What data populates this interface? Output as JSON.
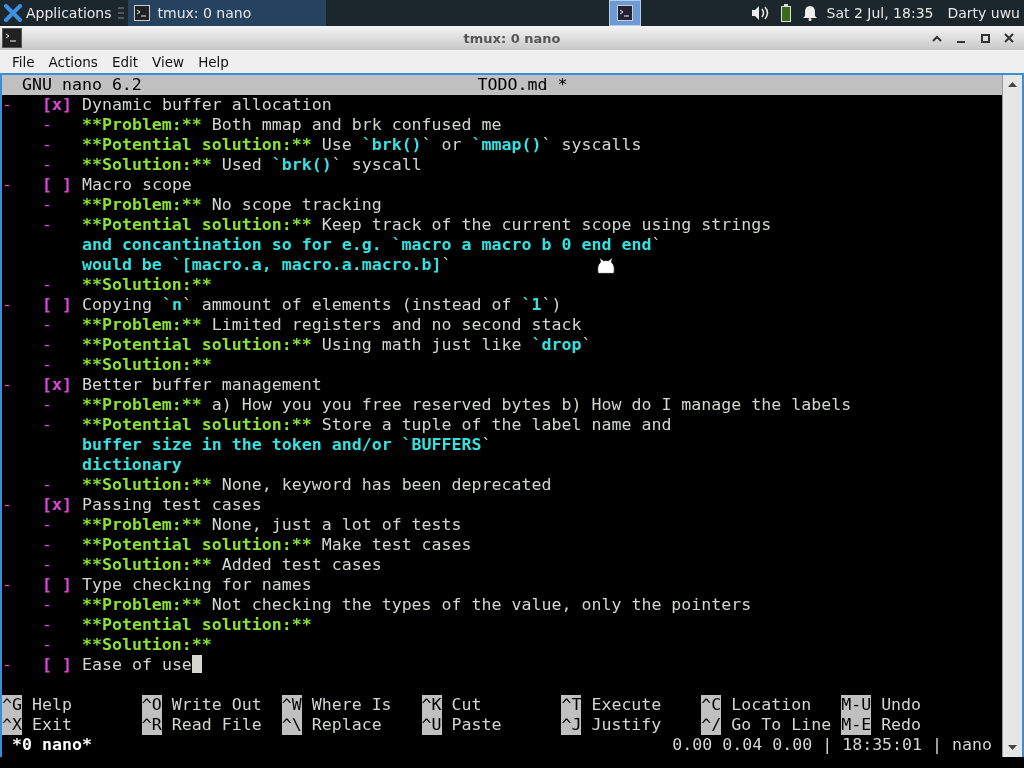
{
  "panel": {
    "apps_label": "Applications",
    "tasks": [
      {
        "title": "tmux: 0 nano",
        "selected": true
      }
    ],
    "clock": "Sat  2 Jul, 18:35",
    "user": "Darty uwu"
  },
  "window": {
    "title": "tmux: 0 nano",
    "menu": [
      "File",
      "Actions",
      "Edit",
      "View",
      "Help"
    ]
  },
  "nano": {
    "version": "GNU nano 6.2",
    "filename": "TODO.md *",
    "lines": [
      {
        "kind": "item",
        "segments": [
          {
            "kind": "bullet",
            "text": "-"
          },
          {
            "kind": "checkbox",
            "text": "[x]"
          },
          {
            "kind": "plain",
            "text": "Dynamic buffer allocation"
          }
        ]
      },
      {
        "kind": "sub",
        "segments": [
          {
            "kind": "bullet",
            "text": "-"
          },
          {
            "kind": "label",
            "text": "**Problem:**"
          },
          {
            "kind": "plain",
            "text": " Both mmap and brk confused me"
          }
        ]
      },
      {
        "kind": "sub",
        "segments": [
          {
            "kind": "bullet",
            "text": "-"
          },
          {
            "kind": "label",
            "text": "**Potential solution:**"
          },
          {
            "kind": "plain",
            "text": " Use "
          },
          {
            "kind": "code",
            "text": "`brk()"
          },
          {
            "kind": "plain",
            "text": "` or "
          },
          {
            "kind": "code",
            "text": "`mmap()"
          },
          {
            "kind": "plain",
            "text": "` syscalls"
          }
        ]
      },
      {
        "kind": "sub",
        "segments": [
          {
            "kind": "bullet",
            "text": "-"
          },
          {
            "kind": "label",
            "text": "**Solution:**"
          },
          {
            "kind": "plain",
            "text": " Used "
          },
          {
            "kind": "code",
            "text": "`brk()"
          },
          {
            "kind": "plain",
            "text": "` syscall"
          }
        ]
      },
      {
        "kind": "item",
        "segments": [
          {
            "kind": "bullet",
            "text": "-"
          },
          {
            "kind": "checkbox",
            "text": "[ ]"
          },
          {
            "kind": "plain",
            "text": "Macro scope"
          }
        ]
      },
      {
        "kind": "sub",
        "segments": [
          {
            "kind": "bullet",
            "text": "-"
          },
          {
            "kind": "label",
            "text": "**Problem:**"
          },
          {
            "kind": "plain",
            "text": " No scope tracking"
          }
        ]
      },
      {
        "kind": "sub",
        "segments": [
          {
            "kind": "bullet",
            "text": "-"
          },
          {
            "kind": "label",
            "text": "**Potential solution:**"
          },
          {
            "kind": "plain",
            "text": " Keep track of the current scope using strings"
          }
        ]
      },
      {
        "kind": "cont",
        "segments": [
          {
            "kind": "code",
            "text": "and concantination so for e.g. `macro a macro b 0 end end"
          },
          {
            "kind": "plain",
            "text": "`"
          }
        ]
      },
      {
        "kind": "cont",
        "segments": [
          {
            "kind": "code",
            "text": "would be `[macro.a, macro.a.macro.b]"
          },
          {
            "kind": "plain",
            "text": "`"
          }
        ]
      },
      {
        "kind": "sub",
        "segments": [
          {
            "kind": "bullet",
            "text": "-"
          },
          {
            "kind": "label",
            "text": "**Solution:**"
          }
        ]
      },
      {
        "kind": "item",
        "segments": [
          {
            "kind": "bullet",
            "text": "-"
          },
          {
            "kind": "checkbox",
            "text": "[ ]"
          },
          {
            "kind": "plain",
            "text": "Copying "
          },
          {
            "kind": "code",
            "text": "`n"
          },
          {
            "kind": "plain",
            "text": "` ammount of elements (instead of "
          },
          {
            "kind": "code",
            "text": "`1"
          },
          {
            "kind": "plain",
            "text": "`)"
          }
        ]
      },
      {
        "kind": "sub",
        "segments": [
          {
            "kind": "bullet",
            "text": "-"
          },
          {
            "kind": "label",
            "text": "**Problem:**"
          },
          {
            "kind": "plain",
            "text": " Limited registers and no second stack"
          }
        ]
      },
      {
        "kind": "sub",
        "segments": [
          {
            "kind": "bullet",
            "text": "-"
          },
          {
            "kind": "label",
            "text": "**Potential solution:**"
          },
          {
            "kind": "plain",
            "text": " Using math just like "
          },
          {
            "kind": "code",
            "text": "`drop"
          },
          {
            "kind": "plain",
            "text": "`"
          }
        ]
      },
      {
        "kind": "sub",
        "segments": [
          {
            "kind": "bullet",
            "text": "-"
          },
          {
            "kind": "label",
            "text": "**Solution:**"
          }
        ]
      },
      {
        "kind": "item",
        "segments": [
          {
            "kind": "bullet",
            "text": "-"
          },
          {
            "kind": "checkbox",
            "text": "[x]"
          },
          {
            "kind": "plain",
            "text": "Better buffer management"
          }
        ]
      },
      {
        "kind": "sub",
        "segments": [
          {
            "kind": "bullet",
            "text": "-"
          },
          {
            "kind": "label",
            "text": "**Problem:**"
          },
          {
            "kind": "plain",
            "text": " a) How you you free reserved bytes b) How do I manage the labels"
          }
        ]
      },
      {
        "kind": "sub",
        "segments": [
          {
            "kind": "bullet",
            "text": "-"
          },
          {
            "kind": "label",
            "text": "**Potential solution:**"
          },
          {
            "kind": "plain",
            "text": " Store a tuple of the label name and"
          }
        ]
      },
      {
        "kind": "cont",
        "segments": [
          {
            "kind": "code",
            "text": "buffer size in the token and/or `BUFFERS"
          },
          {
            "kind": "plain",
            "text": "`"
          }
        ]
      },
      {
        "kind": "cont",
        "segments": [
          {
            "kind": "code",
            "text": "dictionary"
          }
        ]
      },
      {
        "kind": "sub",
        "segments": [
          {
            "kind": "bullet",
            "text": "-"
          },
          {
            "kind": "label",
            "text": "**Solution:**"
          },
          {
            "kind": "plain",
            "text": " None, keyword has been deprecated"
          }
        ]
      },
      {
        "kind": "item",
        "segments": [
          {
            "kind": "bullet",
            "text": "-"
          },
          {
            "kind": "checkbox",
            "text": "[x]"
          },
          {
            "kind": "plain",
            "text": "Passing test cases"
          }
        ]
      },
      {
        "kind": "sub",
        "segments": [
          {
            "kind": "bullet",
            "text": "-"
          },
          {
            "kind": "label",
            "text": "**Problem:**"
          },
          {
            "kind": "plain",
            "text": " None, just a lot of tests"
          }
        ]
      },
      {
        "kind": "sub",
        "segments": [
          {
            "kind": "bullet",
            "text": "-"
          },
          {
            "kind": "label",
            "text": "**Potential solution:**"
          },
          {
            "kind": "plain",
            "text": " Make test cases"
          }
        ]
      },
      {
        "kind": "sub",
        "segments": [
          {
            "kind": "bullet",
            "text": "-"
          },
          {
            "kind": "label",
            "text": "**Solution:**"
          },
          {
            "kind": "plain",
            "text": " Added test cases"
          }
        ]
      },
      {
        "kind": "item",
        "segments": [
          {
            "kind": "bullet",
            "text": "-"
          },
          {
            "kind": "checkbox",
            "text": "[ ]"
          },
          {
            "kind": "plain",
            "text": "Type checking for names"
          }
        ]
      },
      {
        "kind": "sub",
        "segments": [
          {
            "kind": "bullet",
            "text": "-"
          },
          {
            "kind": "label",
            "text": "**Problem:**"
          },
          {
            "kind": "plain",
            "text": " Not checking the types of the value, only the pointers"
          }
        ]
      },
      {
        "kind": "sub",
        "segments": [
          {
            "kind": "bullet",
            "text": "-"
          },
          {
            "kind": "label",
            "text": "**Potential solution:**"
          }
        ]
      },
      {
        "kind": "sub",
        "segments": [
          {
            "kind": "bullet",
            "text": "-"
          },
          {
            "kind": "label",
            "text": "**Solution:**"
          }
        ]
      },
      {
        "kind": "item",
        "cursor": true,
        "segments": [
          {
            "kind": "bullet",
            "text": "-"
          },
          {
            "kind": "checkbox",
            "text": "[ ]"
          },
          {
            "kind": "plain",
            "text": "Ease of use"
          }
        ]
      }
    ],
    "shortcuts": [
      {
        "key": "^G",
        "label": "Help"
      },
      {
        "key": "^O",
        "label": "Write Out"
      },
      {
        "key": "^W",
        "label": "Where Is"
      },
      {
        "key": "^K",
        "label": "Cut"
      },
      {
        "key": "^T",
        "label": "Execute"
      },
      {
        "key": "^C",
        "label": "Location"
      },
      {
        "key": "M-U",
        "label": "Undo"
      },
      {
        "key": "^X",
        "label": "Exit"
      },
      {
        "key": "^R",
        "label": "Read File"
      },
      {
        "key": "^\\",
        "label": "Replace"
      },
      {
        "key": "^U",
        "label": "Paste"
      },
      {
        "key": "^J",
        "label": "Justify"
      },
      {
        "key": "^/",
        "label": "Go To Line"
      },
      {
        "key": "M-E",
        "label": "Redo"
      }
    ]
  },
  "tmux": {
    "window": "*0 nano*",
    "status": "0.00 0.04 0.00 | 18:35:01 | nano"
  }
}
